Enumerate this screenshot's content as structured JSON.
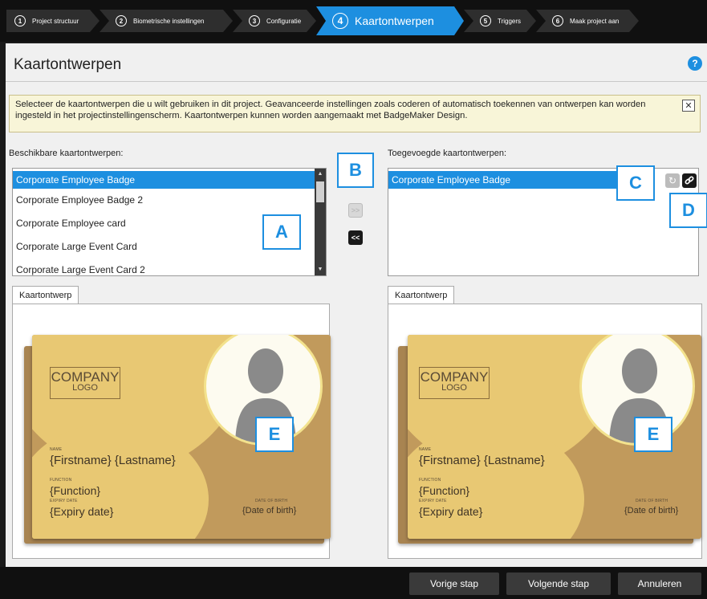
{
  "wizard": {
    "steps": [
      {
        "num": "1",
        "label": "Project structuur"
      },
      {
        "num": "2",
        "label": "Biometrische instellingen"
      },
      {
        "num": "3",
        "label": "Configuratie"
      },
      {
        "num": "4",
        "label": "Kaartontwerpen"
      },
      {
        "num": "5",
        "label": "Triggers"
      },
      {
        "num": "6",
        "label": "Maak project aan"
      }
    ],
    "active_step": 4,
    "active_color": "#1d8fe0"
  },
  "page": {
    "title": "Kaartontwerpen",
    "help": "?"
  },
  "info": {
    "text": "Selecteer de kaartontwerpen die u wilt gebruiken in dit project. Geavanceerde instellingen zoals coderen of automatisch toekennen van ontwerpen kan worden ingesteld in het projectinstellingenscherm. Kaartontwerpen kunnen worden aangemaakt met BadgeMaker Design.",
    "close": "✕"
  },
  "available": {
    "label": "Beschikbare kaartontwerpen:",
    "items": [
      "Corporate Employee Badge",
      "Corporate Employee Badge 2",
      "Corporate Employee card",
      "Corporate Large Event Card",
      "Corporate Large Event Card 2"
    ],
    "selected_index": 0
  },
  "move": {
    "add": ">>",
    "remove": "<<"
  },
  "added": {
    "label": "Toegevoegde kaartontwerpen:",
    "items": [
      "Corporate Employee Badge"
    ]
  },
  "preview": {
    "tab_label": "Kaartontwerp",
    "card": {
      "logo_line1": "COMPANY",
      "logo_line2": "LOGO",
      "name_label": "NAME",
      "name_value": "{Firstname} {Lastname}",
      "function_label": "FUNCTION",
      "function_value": "{Function}",
      "expiry_label": "EXPIRY DATE",
      "expiry_value": "{Expiry date}",
      "dob_label": "DATE OF BIRTH",
      "dob_value": "{Date of birth}"
    }
  },
  "callouts": {
    "a": "A",
    "b": "B",
    "c": "C",
    "d": "D",
    "e": "E"
  },
  "footer": {
    "prev": "Vorige stap",
    "next": "Volgende stap",
    "cancel": "Annuleren"
  }
}
